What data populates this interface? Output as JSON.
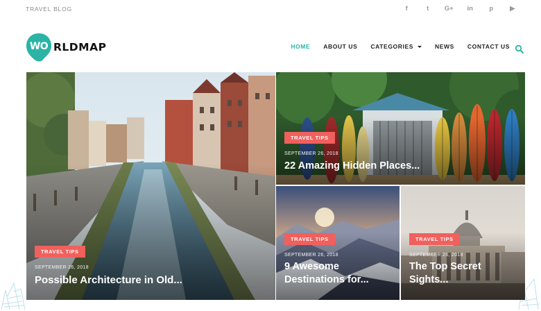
{
  "topbar": {
    "tagline": "TRAVEL BLOG",
    "social": [
      {
        "icon": "facebook-icon",
        "glyph": "f"
      },
      {
        "icon": "twitter-icon",
        "glyph": "t"
      },
      {
        "icon": "google-plus-icon",
        "glyph": "G+"
      },
      {
        "icon": "linkedin-icon",
        "glyph": "in"
      },
      {
        "icon": "pinterest-icon",
        "glyph": "p"
      },
      {
        "icon": "youtube-icon",
        "glyph": "▶"
      }
    ]
  },
  "header": {
    "logo_badge": "WO",
    "logo_text": "RLDMAP",
    "nav": {
      "home": "HOME",
      "about": "ABOUT US",
      "categories": "CATEGORIES",
      "news": "NEWS",
      "contact": "CONTACT US"
    },
    "search_icon": "search-icon"
  },
  "colors": {
    "accent": "#2bb4a6",
    "badge": "#f0605d"
  },
  "posts": [
    {
      "category": "TRAVEL TIPS",
      "date": "SEPTEMBER 26, 2018",
      "title_line1": "Possible Architecture in Old...",
      "title_line2": ""
    },
    {
      "category": "TRAVEL TIPS",
      "date": "SEPTEMBER 26, 2018",
      "title_line1": "22 Amazing Hidden Places...",
      "title_line2": ""
    },
    {
      "category": "TRAVEL TIPS",
      "date": "SEPTEMBER 26, 2018",
      "title_line1": "9 Awesome",
      "title_line2": "Destinations for..."
    },
    {
      "category": "TRAVEL TIPS",
      "date": "SEPTEMBER 26, 2018",
      "title_line1": "The Top Secret",
      "title_line2": "Sights..."
    }
  ]
}
